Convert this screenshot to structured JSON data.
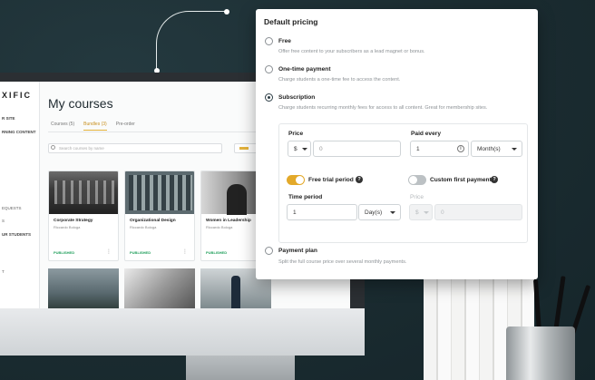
{
  "app": {
    "logo": "XIFIC",
    "sidebar": [
      "R SITE",
      "RNING CONTENT",
      "equests",
      "S",
      "UR STUDENTS",
      "T"
    ],
    "page_title": "My courses",
    "tabs": [
      "Courses (5)",
      "Bundles (3)",
      "Pre-order"
    ],
    "search_placeholder": "Search courses by name",
    "courses": [
      {
        "title": "Corporate Strategy",
        "author": "Riccardo Bologa",
        "status": "PUBLISHED"
      },
      {
        "title": "Organizational Design",
        "author": "Riccardo Bologa",
        "status": "PUBLISHED"
      },
      {
        "title": "Women in Leadership",
        "author": "Riccardo Bologa",
        "status": "PUBLISHED"
      }
    ],
    "kebab": "⋮"
  },
  "pricing": {
    "title": "Default pricing",
    "options": [
      {
        "label": "Free",
        "description": "Offer free content to your subscribers as a lead magnet or bonus."
      },
      {
        "label": "One-time payment",
        "description": "Charge students a one-time fee to access the content."
      },
      {
        "label": "Subscription",
        "description": "Charge students recurring monthly fees for access to all content. Great for membership sites."
      },
      {
        "label": "Payment plan",
        "description": "Split the full course price over several monthly payments."
      }
    ],
    "selected_index": 2,
    "price_label": "Price",
    "currency": "$",
    "price_value": "0",
    "paid_every_label": "Paid every",
    "paid_every_value": "1",
    "period_unit": "Month(s)",
    "info_glyph": "i",
    "help_glyph": "?",
    "free_trial_label": "Free trial period",
    "free_trial_on": true,
    "custom_first_label": "Custom first payment",
    "custom_first_on": false,
    "time_period_label": "Time period",
    "time_period_value": "1",
    "time_period_unit": "Day(s)",
    "price2_label": "Price",
    "currency2": "$",
    "price2_value": "0"
  }
}
